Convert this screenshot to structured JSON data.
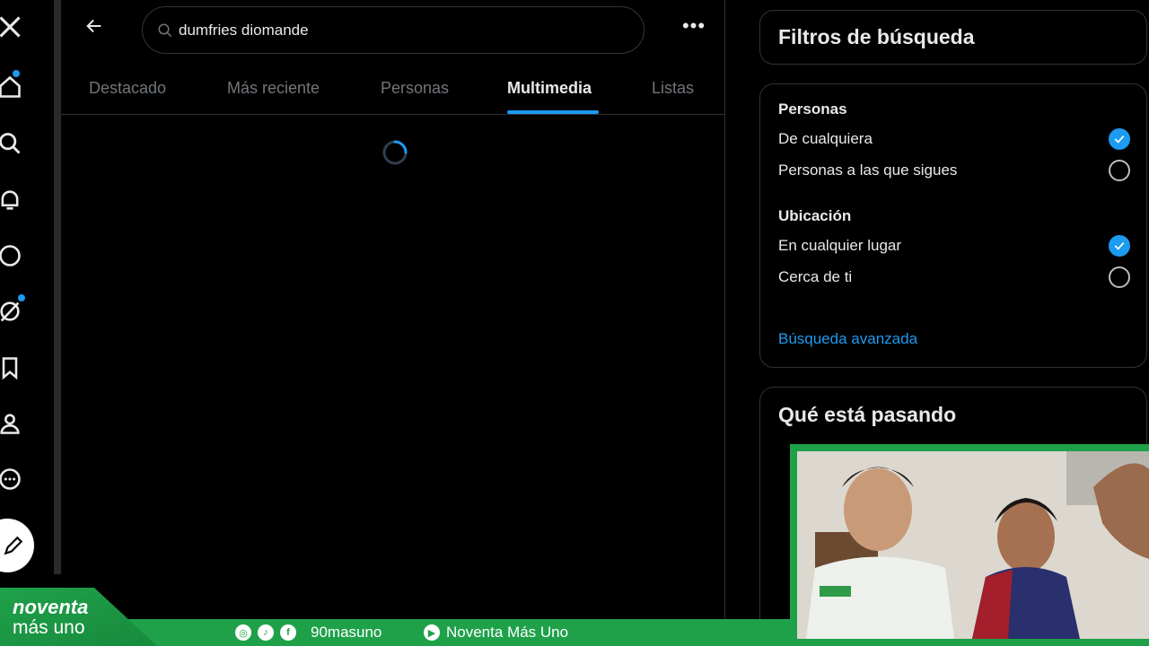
{
  "search": {
    "value": "dumfries diomande"
  },
  "tabs": [
    {
      "label": "Destacado",
      "active": false
    },
    {
      "label": "Más reciente",
      "active": false
    },
    {
      "label": "Personas",
      "active": false
    },
    {
      "label": "Multimedia",
      "active": true
    },
    {
      "label": "Listas",
      "active": false
    }
  ],
  "filters": {
    "title": "Filtros de búsqueda",
    "people_heading": "Personas",
    "people_options": [
      {
        "label": "De cualquiera",
        "selected": true
      },
      {
        "label": "Personas a las que sigues",
        "selected": false
      }
    ],
    "location_heading": "Ubicación",
    "location_options": [
      {
        "label": "En cualquier lugar",
        "selected": true
      },
      {
        "label": "Cerca de ti",
        "selected": false
      }
    ],
    "advanced_link": "Búsqueda avanzada"
  },
  "trending": {
    "title": "Qué está pasando"
  },
  "banner": {
    "brand_top": "noventa",
    "brand_bottom": "más uno",
    "handle": "90masuno",
    "channel": "Noventa Más Uno"
  },
  "colors": {
    "accent": "#1d9bf0",
    "banner_green": "#1fa14a",
    "background": "#000000"
  },
  "icons": [
    "x-logo-icon",
    "home-icon",
    "search-icon",
    "notifications-icon",
    "messages-icon",
    "grok-icon",
    "bookmarks-icon",
    "profile-icon",
    "more-icon",
    "compose-icon",
    "back-arrow-icon",
    "more-options-icon",
    "instagram-icon",
    "tiktok-icon",
    "facebook-icon",
    "youtube-icon"
  ]
}
